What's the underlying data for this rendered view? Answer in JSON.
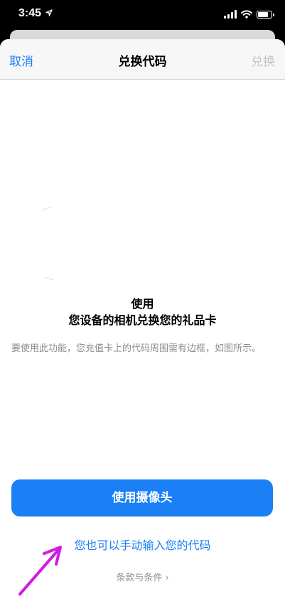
{
  "status_bar": {
    "time": "3:45",
    "location_icon": "location-arrow-icon",
    "signal_icon": "cellular-signal-icon",
    "wifi_icon": "wifi-icon",
    "battery_icon": "battery-icon",
    "battery_level": 0.85
  },
  "nav": {
    "cancel_label": "取消",
    "title": "兑换代码",
    "redeem_label": "兑换"
  },
  "content": {
    "title_line1": "使用",
    "title_line2": "您设备的相机兑换您的礼品卡",
    "hint": "要使用此功能，您充值卡上的代码周围需有边框，如图所示。"
  },
  "actions": {
    "camera_button_label": "使用摄像头",
    "manual_entry_label": "您也可以手动输入您的代码",
    "terms_label": "条款与条件",
    "terms_chevron": "›"
  },
  "colors": {
    "accent": "#1a7ef5",
    "button": "#1b7ff6",
    "disabled": "#c4c4c6",
    "secondary_text": "#8e8e93",
    "annotation_arrow": "#d21be0"
  }
}
